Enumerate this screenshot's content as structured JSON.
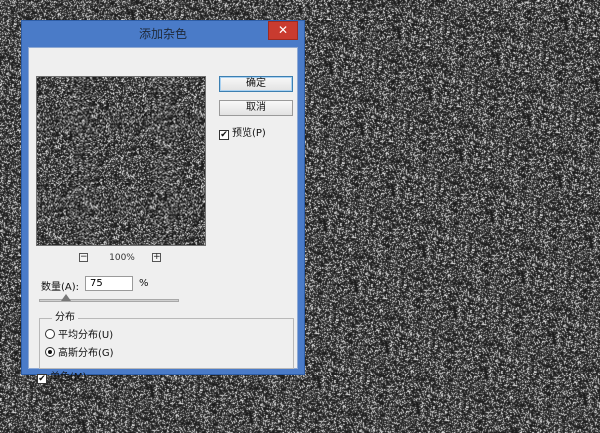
{
  "dialog": {
    "title": "添加杂色",
    "close_glyph": "✕"
  },
  "preview": {
    "zoom_minus": "−",
    "zoom_value": "100%",
    "zoom_plus": "+"
  },
  "buttons": {
    "ok": "确定",
    "cancel": "取消"
  },
  "preview_checkbox": {
    "label": "预览(P)",
    "checked": true
  },
  "amount": {
    "label": "数量(A):",
    "value": "75",
    "unit": "%",
    "slider_fraction": 0.19
  },
  "distribution": {
    "title": "分布",
    "options": [
      {
        "label": "平均分布(U)",
        "selected": false
      },
      {
        "label": "高斯分布(G)",
        "selected": true
      }
    ]
  },
  "monochrome": {
    "label": "单色(M)",
    "checked": true
  },
  "colors": {
    "titlebar": "#4a7bc8",
    "close": "#c93b2f",
    "panel": "#efefef"
  },
  "icons": {
    "checkbox_checked": "checkmark-icon"
  }
}
